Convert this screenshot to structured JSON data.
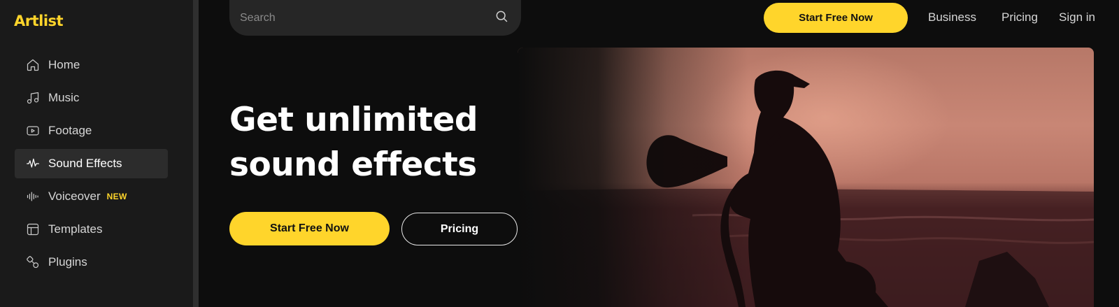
{
  "brand": {
    "logo": "Artlist",
    "accent": "#ffd52b"
  },
  "sidebar": {
    "items": [
      {
        "label": "Home",
        "icon": "home-icon"
      },
      {
        "label": "Music",
        "icon": "music-note-icon"
      },
      {
        "label": "Footage",
        "icon": "video-play-icon"
      },
      {
        "label": "Sound Effects",
        "icon": "waveform-icon",
        "active": true
      },
      {
        "label": "Voiceover",
        "icon": "audio-bars-icon",
        "badge": "NEW"
      },
      {
        "label": "Templates",
        "icon": "template-layout-icon"
      },
      {
        "label": "Plugins",
        "icon": "plugin-icon"
      }
    ]
  },
  "header": {
    "search": {
      "placeholder": "Search",
      "icon": "search-icon"
    },
    "cta": "Start Free Now",
    "links": [
      "Business",
      "Pricing",
      "Sign in"
    ]
  },
  "hero": {
    "title_line1": "Get unlimited",
    "title_line2": "sound effects",
    "primary_button": "Start Free Now",
    "secondary_button": "Pricing"
  }
}
